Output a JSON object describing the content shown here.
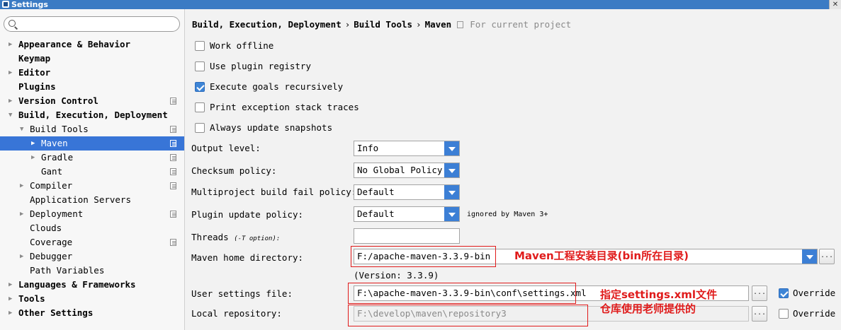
{
  "window": {
    "title": "Settings",
    "close_glyph": "✕"
  },
  "search": {
    "placeholder": "",
    "value": ""
  },
  "sidebar": {
    "items": [
      {
        "label": "Appearance & Behavior",
        "level": 0,
        "bold": true,
        "arrow": "right"
      },
      {
        "label": "Keymap",
        "level": 0,
        "bold": true,
        "arrow": ""
      },
      {
        "label": "Editor",
        "level": 0,
        "bold": true,
        "arrow": "right"
      },
      {
        "label": "Plugins",
        "level": 0,
        "bold": true,
        "arrow": ""
      },
      {
        "label": "Version Control",
        "level": 0,
        "bold": true,
        "arrow": "right",
        "project": true
      },
      {
        "label": "Build, Execution, Deployment",
        "level": 0,
        "bold": true,
        "arrow": "down"
      },
      {
        "label": "Build Tools",
        "level": 1,
        "bold": false,
        "arrow": "down",
        "project": true
      },
      {
        "label": "Maven",
        "level": 2,
        "bold": false,
        "arrow": "right",
        "project": true,
        "selected": true
      },
      {
        "label": "Gradle",
        "level": 2,
        "bold": false,
        "arrow": "right",
        "project": true
      },
      {
        "label": "Gant",
        "level": 2,
        "bold": false,
        "arrow": "",
        "project": true
      },
      {
        "label": "Compiler",
        "level": 1,
        "bold": false,
        "arrow": "right",
        "project": true
      },
      {
        "label": "Application Servers",
        "level": 1,
        "bold": false,
        "arrow": ""
      },
      {
        "label": "Deployment",
        "level": 1,
        "bold": false,
        "arrow": "right",
        "project": true
      },
      {
        "label": "Clouds",
        "level": 1,
        "bold": false,
        "arrow": ""
      },
      {
        "label": "Coverage",
        "level": 1,
        "bold": false,
        "arrow": "",
        "project": true
      },
      {
        "label": "Debugger",
        "level": 1,
        "bold": false,
        "arrow": "right"
      },
      {
        "label": "Path Variables",
        "level": 1,
        "bold": false,
        "arrow": ""
      },
      {
        "label": "Languages & Frameworks",
        "level": 0,
        "bold": true,
        "arrow": "right"
      },
      {
        "label": "Tools",
        "level": 0,
        "bold": true,
        "arrow": "right"
      },
      {
        "label": "Other Settings",
        "level": 0,
        "bold": true,
        "arrow": "right"
      }
    ]
  },
  "breadcrumb": {
    "parts": [
      "Build, Execution, Deployment",
      "Build Tools",
      "Maven"
    ],
    "separator": "›",
    "hint": "For current project"
  },
  "checkboxes": [
    {
      "label": "Work offline",
      "checked": false
    },
    {
      "label": "Use plugin registry",
      "checked": false
    },
    {
      "label": "Execute goals recursively",
      "checked": true
    },
    {
      "label": "Print exception stack traces",
      "checked": false
    },
    {
      "label": "Always update snapshots",
      "checked": false
    }
  ],
  "fields": {
    "output_level": {
      "label": "Output level:",
      "value": "Info"
    },
    "checksum_policy": {
      "label": "Checksum policy:",
      "value": "No Global Policy"
    },
    "multiproject_fail": {
      "label": "Multiproject build fail policy:",
      "value": "Default"
    },
    "plugin_update": {
      "label": "Plugin update policy:",
      "value": "Default",
      "note": "ignored by Maven 3+"
    },
    "threads": {
      "label": "Threads",
      "hint": "(-T option):",
      "value": ""
    },
    "maven_home": {
      "label": "Maven home directory:",
      "value": "F:/apache-maven-3.3.9-bin",
      "version": "(Version: 3.3.9)"
    },
    "user_settings": {
      "label": "User settings file:",
      "value": "F:\\apache-maven-3.3.9-bin\\conf\\settings.xml",
      "override_label": "Override",
      "override_checked": true
    },
    "local_repo": {
      "label": "Local repository:",
      "value": "F:\\develop\\maven\\repository3",
      "override_label": "Override",
      "override_checked": false
    },
    "browse_label": "..."
  },
  "annotations": {
    "maven_home": "Maven工程安装目录(bin所在目录)",
    "settings_1": "指定settings.xml文件",
    "settings_2": "仓库使用老师提供的"
  },
  "colors": {
    "accent": "#3875d7",
    "annotation": "#e01b1b",
    "title_bar": "#3b7bc4"
  }
}
